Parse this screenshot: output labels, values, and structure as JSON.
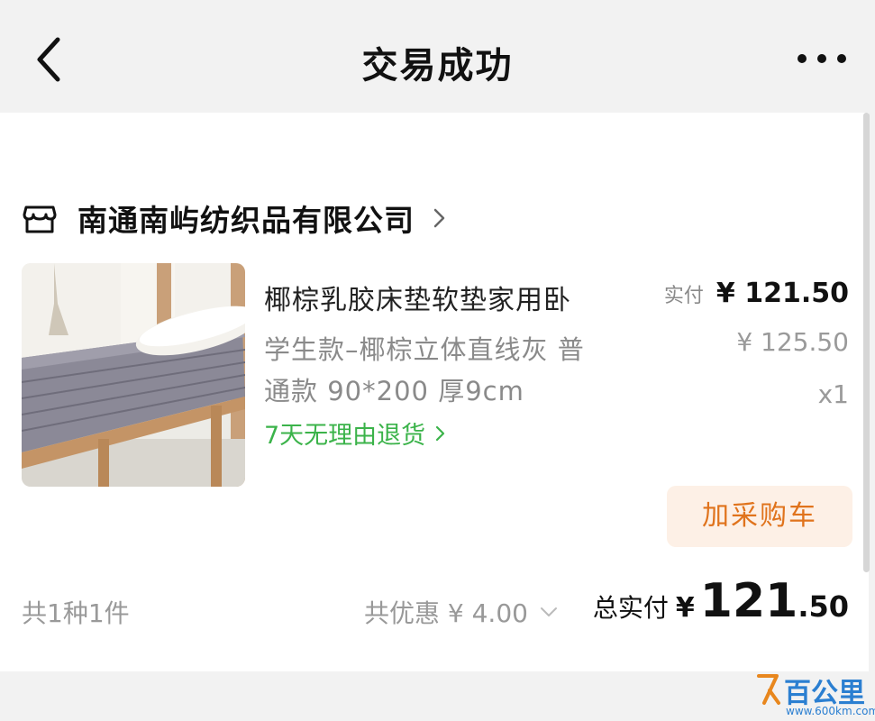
{
  "header": {
    "title": "交易成功"
  },
  "shop": {
    "name": "南通南屿纺织品有限公司"
  },
  "product": {
    "title": "椰棕乳胶床垫软垫家用卧",
    "spec_line1": "学生款–椰棕立体直线灰 普",
    "spec_line2": "通款 90*200 厚9cm",
    "return_policy": "7天无理由退货",
    "paid_label": "实付",
    "paid_price": "¥ 121.50",
    "original_price": "¥ 125.50",
    "quantity": "x1",
    "add_to_cart": "加采购车"
  },
  "summary": {
    "count": "共1种1件",
    "discount": "共优惠 ¥ 4.00",
    "total_label": "总实付",
    "total_currency": "¥",
    "total_int": "121",
    "total_dec": ".50"
  },
  "watermark": {
    "brand": "百公里",
    "url": "www.600km.com"
  },
  "colors": {
    "accent_orange": "#e0731c",
    "button_bg": "#fdf0e6",
    "green": "#3bb34a",
    "background": "#f2f2f2"
  }
}
